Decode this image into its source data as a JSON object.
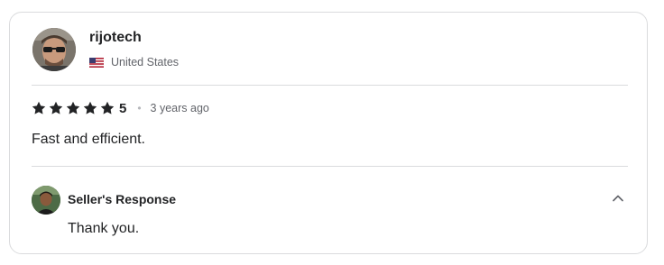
{
  "review": {
    "username": "rijotech",
    "country": "United States",
    "flag_icon": "us-flag-icon",
    "rating": "5",
    "stars_count": 5,
    "time_ago": "3 years ago",
    "text": "Fast and efficient."
  },
  "seller_response": {
    "label": "Seller's Response",
    "text": "Thank you.",
    "toggle_icon": "chevron-up-icon"
  },
  "colors": {
    "text_primary": "#222325",
    "text_secondary": "#62646a",
    "border": "#dadbdd",
    "star": "#222325"
  }
}
